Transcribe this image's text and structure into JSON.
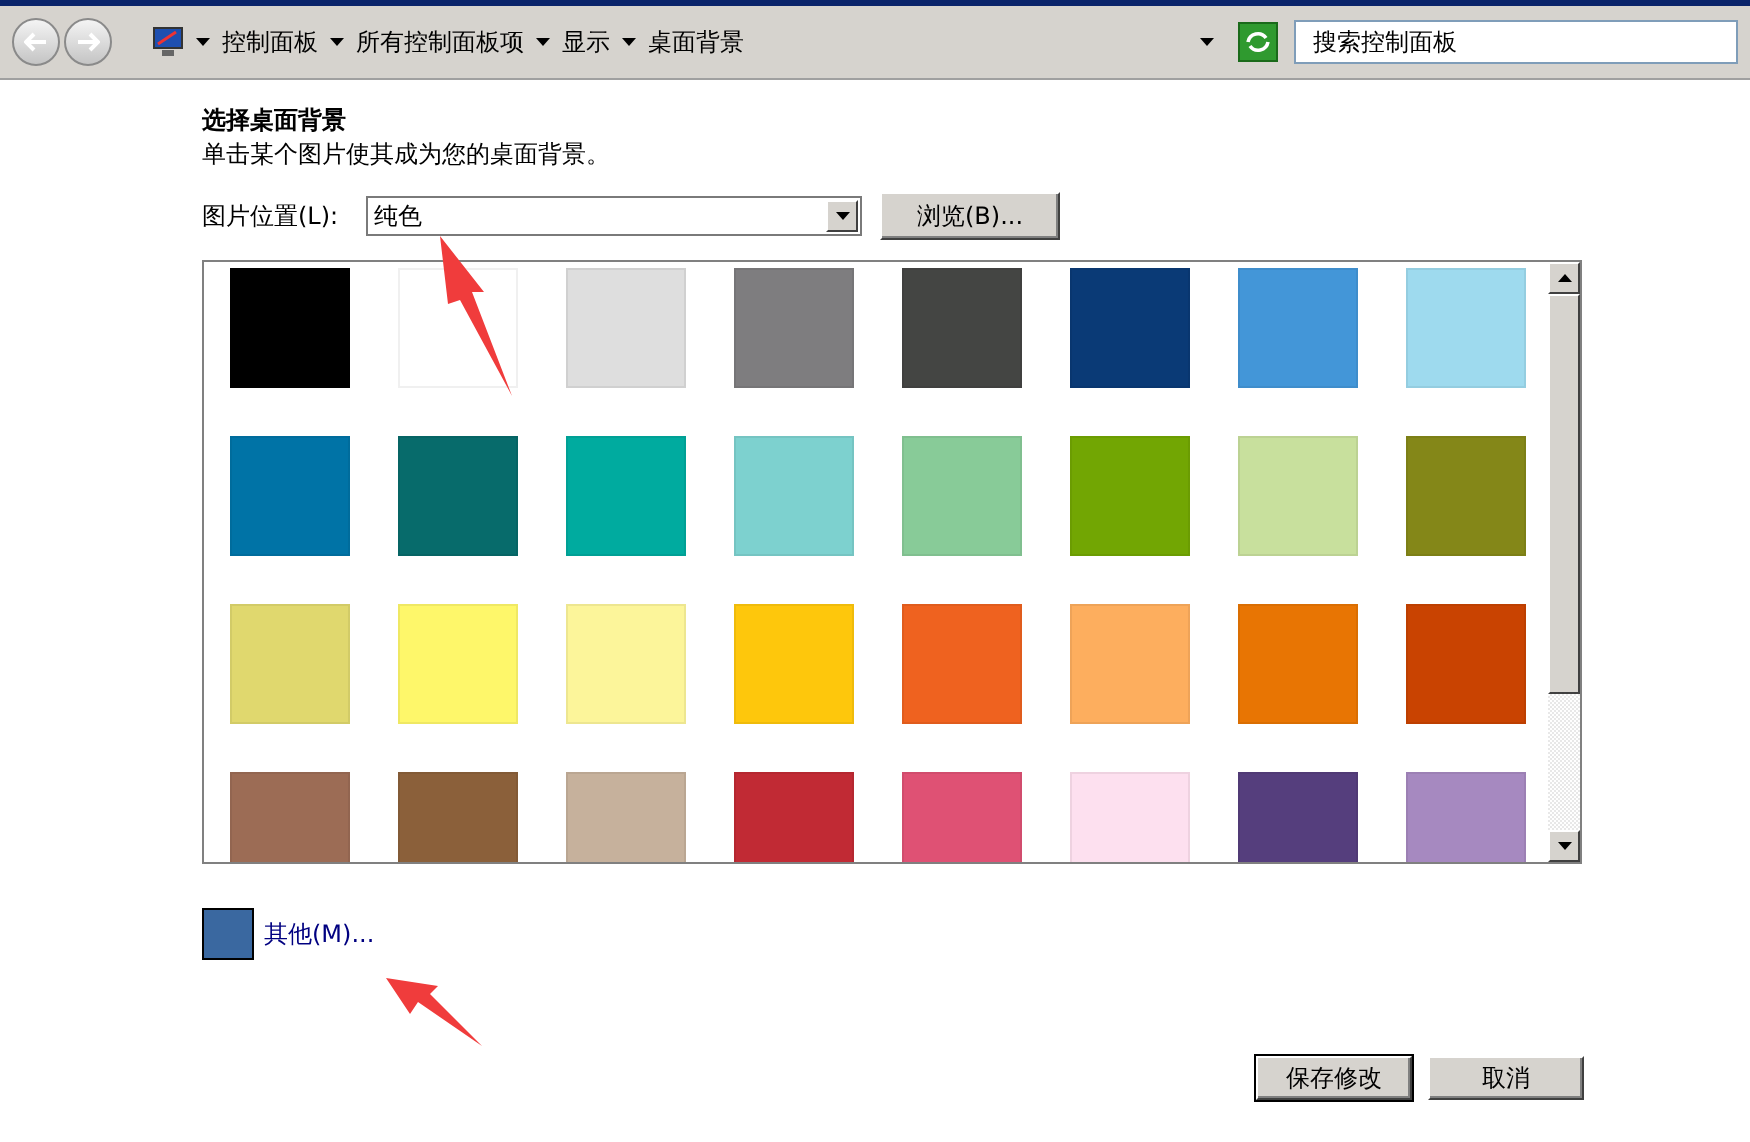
{
  "address_bar": {
    "breadcrumbs": [
      "控制面板",
      "所有控制面板项",
      "显示",
      "桌面背景"
    ]
  },
  "search": {
    "placeholder": "搜索控制面板"
  },
  "heading": "选择桌面背景",
  "instructions": "单击某个图片使其成为您的桌面背景。",
  "location": {
    "label": "图片位置(L):",
    "value": "纯色",
    "browse_button": "浏览(B)..."
  },
  "swatches": [
    {
      "color": "#000000"
    },
    {
      "color": "#ffffff"
    },
    {
      "color": "#dedede"
    },
    {
      "color": "#7e7d7f"
    },
    {
      "color": "#444543"
    },
    {
      "color": "#0a3a76"
    },
    {
      "color": "#4396d8"
    },
    {
      "color": "#9edaee"
    },
    {
      "color": "#0073a6"
    },
    {
      "color": "#076b6b"
    },
    {
      "color": "#00ab9f"
    },
    {
      "color": "#7dd1cf"
    },
    {
      "color": "#88cb98"
    },
    {
      "color": "#72a603"
    },
    {
      "color": "#c8e09d"
    },
    {
      "color": "#848718"
    },
    {
      "color": "#e0d86e"
    },
    {
      "color": "#fef76a"
    },
    {
      "color": "#fcf59a"
    },
    {
      "color": "#fec70c"
    },
    {
      "color": "#ef621f"
    },
    {
      "color": "#fdae5e"
    },
    {
      "color": "#e87503"
    },
    {
      "color": "#c94301"
    },
    {
      "color": "#9c6c55"
    },
    {
      "color": "#8b603a"
    },
    {
      "color": "#c6b19c"
    },
    {
      "color": "#c12a34"
    },
    {
      "color": "#df5174"
    },
    {
      "color": "#fde0ef"
    },
    {
      "color": "#553e7d"
    },
    {
      "color": "#a689c0"
    }
  ],
  "custom_color": {
    "color": "#3a68a0",
    "link": "其他(M)..."
  },
  "buttons": [
    "保存修改",
    "取消"
  ]
}
